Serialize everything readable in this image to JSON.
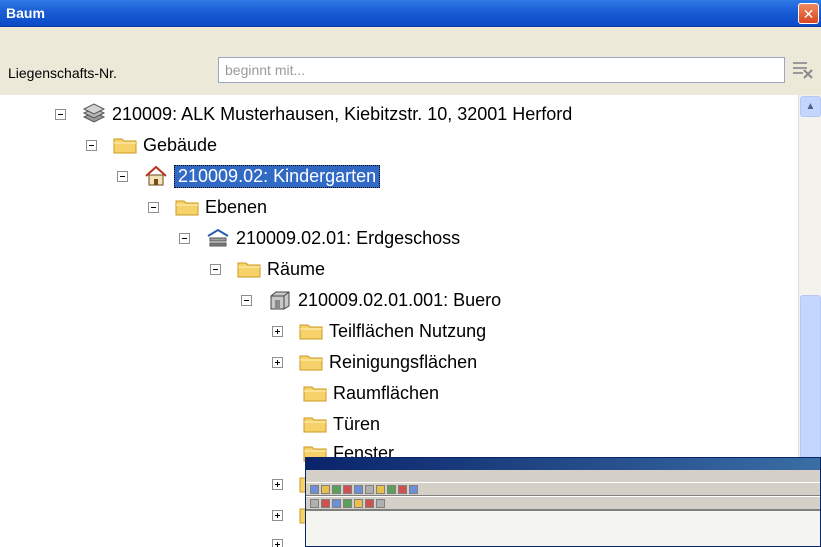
{
  "window": {
    "title": "Baum"
  },
  "search": {
    "label": "Liegenschafts-Nr.",
    "placeholder": "beginnt mit..."
  },
  "tree": {
    "nodes": [
      {
        "label": "210009: ALK Musterhausen, Kiebitzstr. 10, 32001 Herford",
        "icon": "layers-icon",
        "expander": "collapse"
      },
      {
        "label": "Gebäude",
        "icon": "folder-icon",
        "expander": "collapse"
      },
      {
        "label": "210009.02: Kindergarten",
        "icon": "house-icon",
        "expander": "collapse",
        "selected": true
      },
      {
        "label": "Ebenen",
        "icon": "folder-icon",
        "expander": "collapse"
      },
      {
        "label": "210009.02.01: Erdgeschoss",
        "icon": "floor-icon",
        "expander": "collapse"
      },
      {
        "label": "Räume",
        "icon": "folder-icon",
        "expander": "collapse"
      },
      {
        "label": "210009.02.01.001: Buero",
        "icon": "room-icon",
        "expander": "collapse"
      },
      {
        "label": "Teilflächen Nutzung",
        "icon": "folder-icon",
        "expander": "expand"
      },
      {
        "label": "Reinigungsflächen",
        "icon": "folder-icon",
        "expander": "expand"
      },
      {
        "label": "Raumflächen",
        "icon": "folder-icon",
        "expander": "none"
      },
      {
        "label": "Türen",
        "icon": "folder-icon",
        "expander": "none"
      },
      {
        "label": "Fenster",
        "icon": "folder-icon",
        "expander": "none"
      }
    ]
  },
  "colors": {
    "titlebar": "#0a49c8",
    "selection": "#316ac5",
    "folder": "#f7d26b",
    "scrollbar_thumb": "#c5d6fc"
  }
}
